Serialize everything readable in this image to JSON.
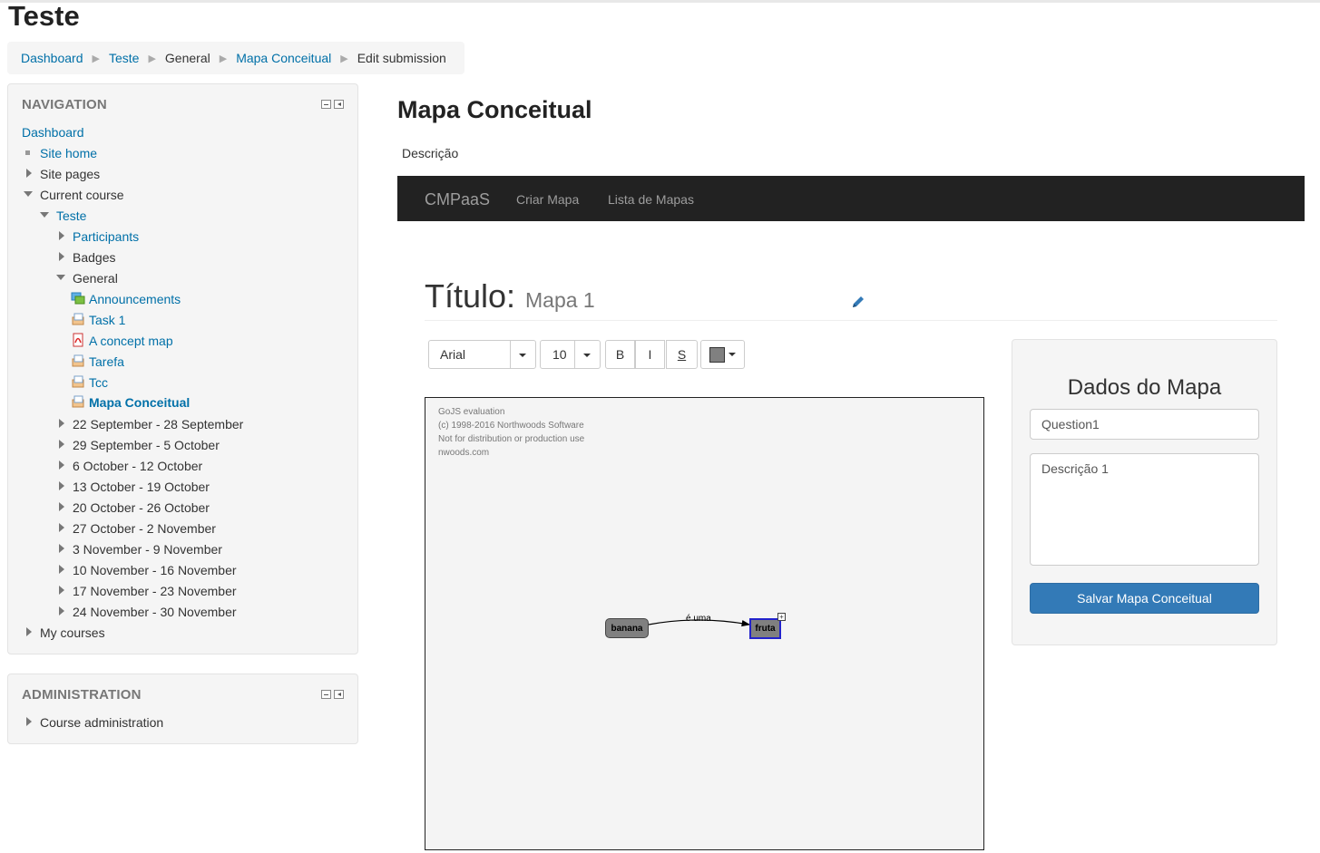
{
  "page": {
    "title": "Teste"
  },
  "breadcrumb": {
    "items": [
      {
        "label": "Dashboard",
        "link": true
      },
      {
        "label": "Teste",
        "link": true
      },
      {
        "label": "General",
        "link": false
      },
      {
        "label": "Mapa Conceitual",
        "link": true
      },
      {
        "label": "Edit submission",
        "link": false
      }
    ]
  },
  "navigation": {
    "title": "NAVIGATION",
    "dashboard": "Dashboard",
    "site_home": "Site home",
    "site_pages": "Site pages",
    "current_course": "Current course",
    "course": "Teste",
    "participants": "Participants",
    "badges": "Badges",
    "general": "General",
    "activities": {
      "announcements": "Announcements",
      "task1": "Task 1",
      "concept_map": "A concept map",
      "tarefa": "Tarefa",
      "tcc": "Tcc",
      "mapa_conceitual": "Mapa Conceitual"
    },
    "weeks": [
      "22 September - 28 September",
      "29 September - 5 October",
      "6 October - 12 October",
      "13 October - 19 October",
      "20 October - 26 October",
      "27 October - 2 November",
      "3 November - 9 November",
      "10 November - 16 November",
      "17 November - 23 November",
      "24 November - 30 November"
    ],
    "my_courses": "My courses"
  },
  "administration": {
    "title": "ADMINISTRATION",
    "course_admin": "Course administration"
  },
  "content": {
    "title": "Mapa Conceitual",
    "description": "Descrição"
  },
  "appbar": {
    "brand": "CMPaaS",
    "links": [
      "Criar Mapa",
      "Lista de Mapas"
    ]
  },
  "map": {
    "title_label": "Título:",
    "title_value": "Mapa 1"
  },
  "toolbar": {
    "font": "Arial",
    "size": "10",
    "bold": "B",
    "italic": "I",
    "strike": "S",
    "color": "#808080"
  },
  "canvas": {
    "watermark": [
      "GoJS evaluation",
      "(c) 1998-2016 Northwoods Software",
      "Not for distribution or production use",
      "nwoods.com"
    ],
    "nodes": {
      "source": "banana",
      "target": "fruta"
    },
    "link_label": "é uma",
    "expand": "+"
  },
  "panel": {
    "title": "Dados do Mapa",
    "question_value": "Question1",
    "description_value": "Descrição 1",
    "save_label": "Salvar Mapa Conceitual"
  },
  "colors": {
    "link": "#0070a8",
    "navbar": "#222222",
    "primary": "#337ab7"
  }
}
